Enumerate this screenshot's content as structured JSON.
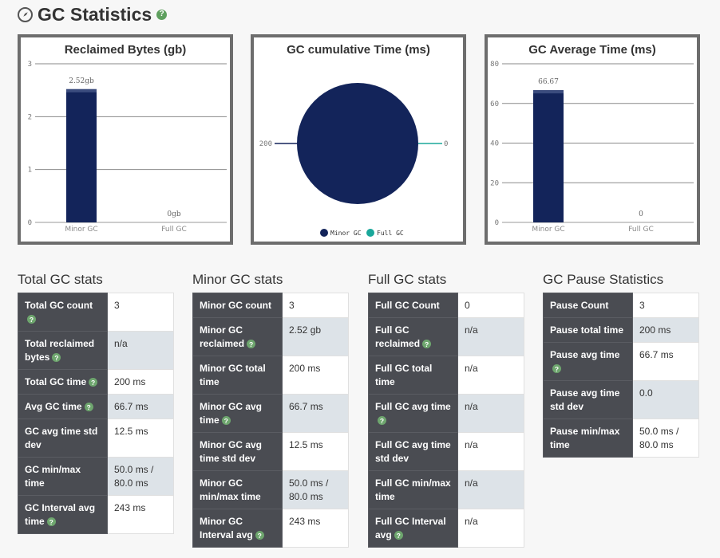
{
  "header": {
    "title": "GC Statistics",
    "help": "?"
  },
  "charts": {
    "reclaimed": {
      "title": "Reclaimed Bytes (gb)",
      "yticks": [
        "0",
        "1",
        "2",
        "3"
      ],
      "categories": [
        "Minor GC",
        "Full GC"
      ],
      "values": [
        2.52,
        0
      ],
      "labels": [
        "2.52gb",
        "0gb"
      ]
    },
    "cumulative": {
      "title": "GC cumulative Time (ms)",
      "slice_labels": [
        "200",
        "0"
      ],
      "legend": [
        "Minor GC",
        "Full GC"
      ]
    },
    "average": {
      "title": "GC Average Time (ms)",
      "yticks": [
        "0",
        "20",
        "40",
        "60",
        "80"
      ],
      "categories": [
        "Minor GC",
        "Full GC"
      ],
      "values": [
        66.67,
        0
      ],
      "labels": [
        "66.67",
        "0"
      ]
    }
  },
  "chart_data": [
    {
      "type": "bar",
      "title": "Reclaimed Bytes (gb)",
      "categories": [
        "Minor GC",
        "Full GC"
      ],
      "values": [
        2.52,
        0
      ],
      "ylim": [
        0,
        3
      ],
      "grid": true
    },
    {
      "type": "pie",
      "title": "GC cumulative Time (ms)",
      "categories": [
        "Minor GC",
        "Full GC"
      ],
      "values": [
        200,
        0
      ],
      "legend": "bottom"
    },
    {
      "type": "bar",
      "title": "GC Average Time (ms)",
      "categories": [
        "Minor GC",
        "Full GC"
      ],
      "values": [
        66.67,
        0
      ],
      "ylim": [
        0,
        80
      ],
      "grid": true
    }
  ],
  "colors": {
    "minor": "#13245a",
    "full": "#1aa79a",
    "key_bg": "#4a4c52",
    "alt_bg": "#dde3e8",
    "help": "#5fa05f"
  },
  "tables": {
    "total": {
      "title": "Total GC stats",
      "rows": [
        {
          "key": "Total GC count",
          "value": "3"
        },
        {
          "key": "Total reclaimed bytes",
          "value": "n/a"
        },
        {
          "key": "Total GC time",
          "value": "200 ms"
        },
        {
          "key": "Avg GC time",
          "value": "66.7 ms"
        },
        {
          "key": "GC avg time std dev",
          "value": "12.5 ms"
        },
        {
          "key": "GC min/max time",
          "value": "50.0 ms / 80.0 ms"
        },
        {
          "key": "GC Interval avg time",
          "value": "243 ms"
        }
      ]
    },
    "minor": {
      "title": "Minor GC stats",
      "rows": [
        {
          "key": "Minor GC count",
          "value": "3"
        },
        {
          "key": "Minor GC reclaimed",
          "value": "2.52 gb"
        },
        {
          "key": "Minor GC total time",
          "value": "200 ms"
        },
        {
          "key": "Minor GC avg time",
          "value": "66.7 ms"
        },
        {
          "key": "Minor GC avg time std dev",
          "value": "12.5 ms"
        },
        {
          "key": "Minor GC min/max time",
          "value": "50.0 ms / 80.0 ms"
        },
        {
          "key": "Minor GC Interval avg",
          "value": "243 ms"
        }
      ]
    },
    "full": {
      "title": "Full GC stats",
      "rows": [
        {
          "key": "Full GC Count",
          "value": "0"
        },
        {
          "key": "Full GC reclaimed",
          "value": "n/a"
        },
        {
          "key": "Full GC total time",
          "value": "n/a"
        },
        {
          "key": "Full GC avg time",
          "value": "n/a"
        },
        {
          "key": "Full GC avg time std dev",
          "value": "n/a"
        },
        {
          "key": "Full GC min/max time",
          "value": "n/a"
        },
        {
          "key": "Full GC Interval avg",
          "value": "n/a"
        }
      ]
    },
    "pause": {
      "title": "GC Pause Statistics",
      "rows": [
        {
          "key": "Pause Count",
          "value": "3"
        },
        {
          "key": "Pause total time",
          "value": "200 ms"
        },
        {
          "key": "Pause avg time",
          "value": "66.7 ms"
        },
        {
          "key": "Pause avg time std dev",
          "value": "0.0"
        },
        {
          "key": "Pause min/max time",
          "value": "50.0 ms / 80.0 ms"
        }
      ]
    }
  }
}
